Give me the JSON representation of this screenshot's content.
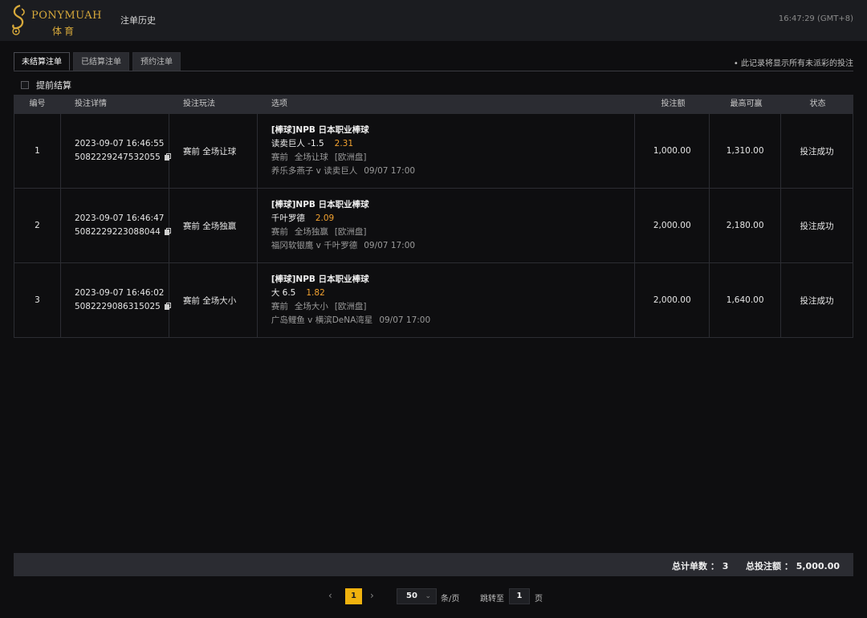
{
  "header": {
    "logo_text": "PONYMUAH",
    "logo_sub": "体育",
    "nav_history": "注单历史",
    "clock": "16:47:29 (GMT+8)"
  },
  "tabs": [
    {
      "label": "未结算注单",
      "active": true
    },
    {
      "label": "已结算注单",
      "active": false
    },
    {
      "label": "预约注单",
      "active": false
    }
  ],
  "note": "• 此记录将显示所有未派彩的投注",
  "early_settle": {
    "label": "提前结算",
    "checked": false
  },
  "table": {
    "headers": [
      "编号",
      "投注详情",
      "投注玩法",
      "选项",
      "投注额",
      "最高可赢",
      "状态"
    ],
    "rows": [
      {
        "no": "1",
        "datetime": "2023-09-07 16:46:55",
        "ticket": "5082229247532055",
        "play": "赛前 全场让球",
        "league": "[棒球]NPB 日本职业棒球",
        "pick": "读卖巨人 -1.5",
        "odds": "2.31",
        "market_a": "赛前",
        "market_b": "全场让球",
        "market_c": "[欧洲盘]",
        "match": "养乐多燕子 v 读卖巨人",
        "match_time": "09/07 17:00",
        "stake": "1,000.00",
        "max_win": "1,310.00",
        "status": "投注成功"
      },
      {
        "no": "2",
        "datetime": "2023-09-07 16:46:47",
        "ticket": "5082229223088044",
        "play": "赛前 全场独赢",
        "league": "[棒球]NPB 日本职业棒球",
        "pick": "千叶罗德",
        "odds": "2.09",
        "market_a": "赛前",
        "market_b": "全场独赢",
        "market_c": "[欧洲盘]",
        "match": "福冈软银鹰 v 千叶罗德",
        "match_time": "09/07 17:00",
        "stake": "2,000.00",
        "max_win": "2,180.00",
        "status": "投注成功"
      },
      {
        "no": "3",
        "datetime": "2023-09-07 16:46:02",
        "ticket": "5082229086315025",
        "play": "赛前 全场大小",
        "league": "[棒球]NPB 日本职业棒球",
        "pick": "大 6.5",
        "odds": "1.82",
        "market_a": "赛前",
        "market_b": "全场大小",
        "market_c": "[欧洲盘]",
        "match": "广岛鲤鱼 v 横滨DeNA湾星",
        "match_time": "09/07 17:00",
        "stake": "2,000.00",
        "max_win": "1,640.00",
        "status": "投注成功"
      }
    ]
  },
  "totals": {
    "count_label": "总计单数 ：",
    "count": "3",
    "amount_label": "总投注额 ：",
    "amount": "5,000.00"
  },
  "pagination": {
    "current": "1",
    "page_size": "50",
    "unit": "条/页",
    "jump_label": "跳转至",
    "jump_value": "1",
    "page_label": "页"
  },
  "colors": {
    "accent": "#f0b20e",
    "odds": "#f2a230",
    "logo": "#d7a93b"
  }
}
